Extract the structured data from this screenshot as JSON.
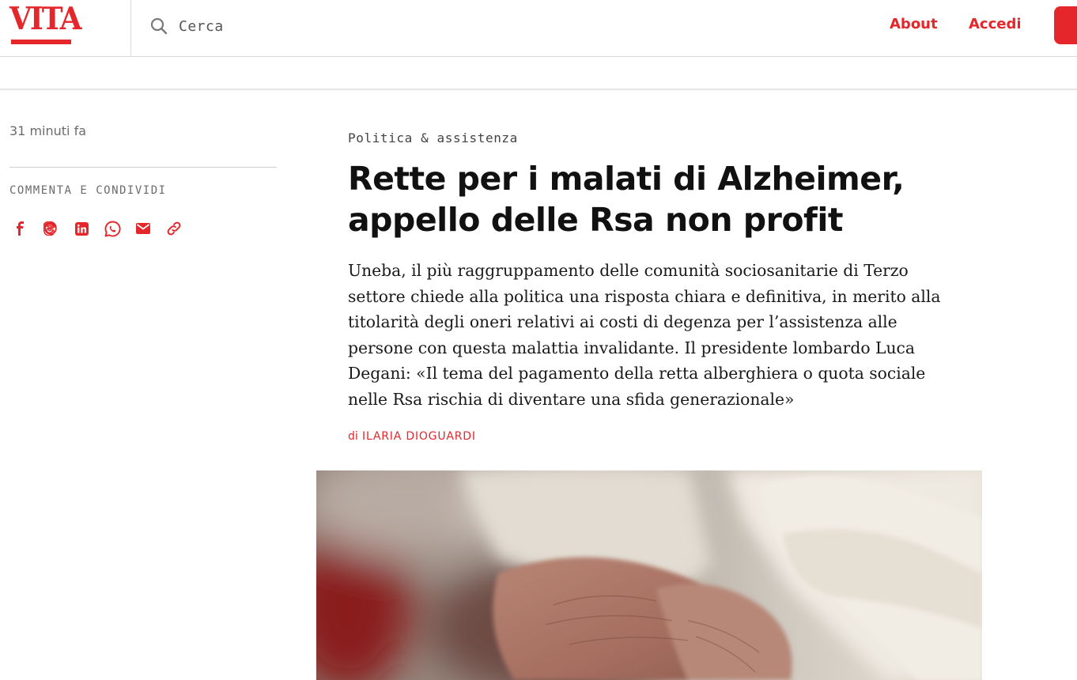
{
  "header": {
    "logo_text": "VITA",
    "search_placeholder": "Cerca",
    "nav": {
      "about": "About",
      "login": "Accedi"
    }
  },
  "sidebar": {
    "timestamp": "31 minuti fa",
    "share_label": "COMMENTA E CONDIVIDI",
    "share_icons": [
      "facebook-icon",
      "threads-icon",
      "linkedin-icon",
      "whatsapp-icon",
      "email-icon",
      "link-icon"
    ]
  },
  "article": {
    "category": "Politica & assistenza",
    "title": "Rette per i malati di Alzheimer, appello delle Rsa non profit",
    "lead": "Uneba, il più raggruppamento delle comunità sociosanitarie di Terzo settore chiede alla politica una risposta chiara e definitiva, in merito alla titolarità degli oneri relativi ai costi di degenza per l’assistenza alle persone con questa malattia invalidante. Il presidente lombardo Luca Degani: «Il tema del pagamento della retta alberghiera o quota sociale nelle Rsa rischia di diventare una sfida generazionale»",
    "byline_prefix": "di",
    "author": "ILARIA DIOGUARDI"
  },
  "colors": {
    "accent": "#e5262b",
    "text": "#111111",
    "muted": "#6b6b6b"
  }
}
